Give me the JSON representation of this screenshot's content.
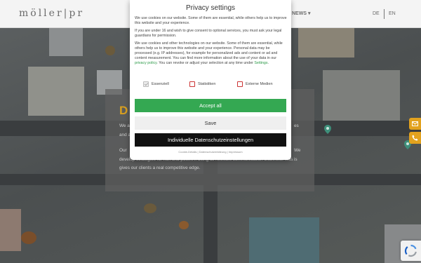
{
  "header": {
    "logo": "möller|pr",
    "nav_news": "NEWS ▾",
    "lang_de": "DE",
    "lang_en": "EN"
  },
  "hero": {
    "title": "D",
    "lines": [
      "We a",
      "and a",
      "Our",
      "develop strategies for rich and potent if using all relevant communication channels. This",
      "gives our clients a real competitive edge."
    ],
    "right_fragments": [
      "es",
      "We",
      "is"
    ]
  },
  "privacy": {
    "title": "Privacy settings",
    "para1": "We use cookies on our website. Some of them are essential, while others help us to improve this website and your experience.",
    "para2": "If you are under 16 and wish to give consent to optional services, you must ask your legal guardians for permission.",
    "para3_before_link": "We use cookies and other technologies on our website. Some of them are essential, while others help us to improve this website and your experience. Personal data may be processed (e.g. IP addresses), for example for personalized ads and content or ad and content measurement. You can find more information about the use of your data in our ",
    "privacy_link": "privacy policy",
    "para3_after_link": ". You can revoke or adjust your selection at any time under ",
    "settings_link": "Settings",
    "para3_end": ".",
    "checkboxes": [
      {
        "label": "Essenziell",
        "checked": true
      },
      {
        "label": "Statistiken",
        "checked": false
      },
      {
        "label": "Externe Medien",
        "checked": false
      }
    ],
    "accept_all": "Accept all",
    "save": "Save",
    "individual": "Individuelle Datenschutzeinstellungen",
    "footer": "Cookie-Details | Datenschutzerklärung | Impressum"
  },
  "colors": {
    "accent_orange": "#e2a21e",
    "accept_green": "#34a852",
    "checkbox_red": "#cc3333"
  }
}
